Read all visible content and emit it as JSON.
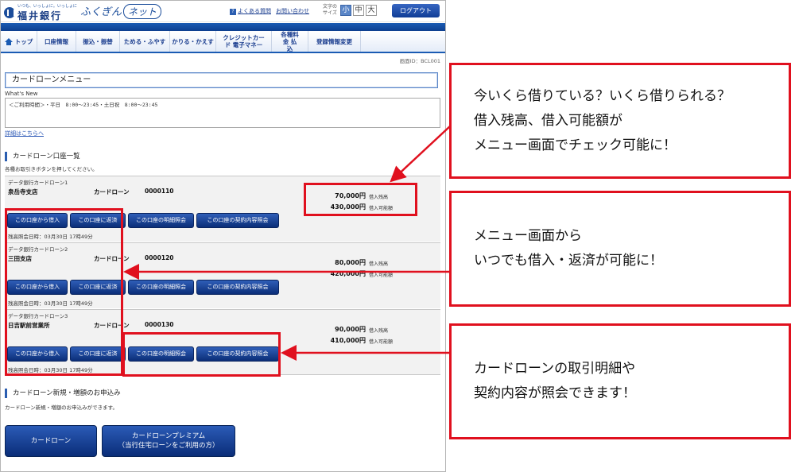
{
  "header": {
    "bank_tagline": "いつも、いっしょに。いっしょに",
    "bank_name": "福井銀行",
    "service_name_a": "ふくぎん",
    "service_name_b": "ネット",
    "faq_link": "よくある質問",
    "contact_link": "お問い合わせ",
    "font_size_label": "文字の サイズ",
    "font_sizes": [
      "小",
      "中",
      "大"
    ],
    "logout_label": "ログアウト"
  },
  "nav": {
    "items": [
      "トップ",
      "口座情報",
      "振込・振替",
      "ためる・ふやす",
      "かりる・かえす",
      "クレジットカード 電子マネー",
      "各種料金 払込",
      "登録情報変更"
    ]
  },
  "screen_id": "画面ID：BCL001",
  "page_title": "カードローンメニュー",
  "whats_new": {
    "label": "What's New",
    "text": "＜ご利用時間＞・平日　8:00～23:45・土日祝　8:00～23:45",
    "detail_link": "詳細はこちらへ"
  },
  "account_section": {
    "heading": "カードローン口座一覧",
    "note": "各種お取引きボタンを押してください。"
  },
  "accounts": [
    {
      "title": "データ銀行カードローン1",
      "branch": "泉岳寺支店",
      "type": "カードローン",
      "number": "0000110",
      "balance": "70,000円",
      "balance_label": "借入残高",
      "available": "430,000円",
      "available_label": "借入可能額",
      "buttons": [
        "この口座から借入",
        "この口座に返済",
        "この口座の明細照会",
        "この口座の契約内容照会"
      ],
      "inquiry_time": "残高照会日時：03月30日 17時49分"
    },
    {
      "title": "データ銀行カードローン2",
      "branch": "三田支店",
      "type": "カードローン",
      "number": "0000120",
      "balance": "80,000円",
      "balance_label": "借入残高",
      "available": "420,000円",
      "available_label": "借入可能額",
      "buttons": [
        "この口座から借入",
        "この口座に返済",
        "この口座の明細照会",
        "この口座の契約内容照会"
      ],
      "inquiry_time": "残高照会日時：03月30日 17時49分"
    },
    {
      "title": "データ銀行カードローン3",
      "branch": "日吉駅前営業所",
      "type": "カードローン",
      "number": "0000130",
      "balance": "90,000円",
      "balance_label": "借入残高",
      "available": "410,000円",
      "available_label": "借入可能額",
      "buttons": [
        "この口座から借入",
        "この口座に返済",
        "この口座の明細照会",
        "この口座の契約内容照会"
      ],
      "inquiry_time": "残高照会日時：03月30日 17時49分"
    }
  ],
  "apply_section": {
    "heading": "カードローン新規・増額のお申込み",
    "note": "カードローン新規・増額のお申込みができます。",
    "buttons": [
      "カードローン",
      "カードローンプレミアム\n（当行住宅ローンをご利用の方）"
    ]
  },
  "callouts": [
    [
      "今いくら借りている？いくら借りられる？",
      "借入残高、借入可能額が",
      "メニュー画面でチェック可能に！"
    ],
    [
      "メニュー画面から",
      "いつでも借入・返済が可能に！"
    ],
    [
      "カードローンの取引明細や",
      "契約内容が照会できます！"
    ]
  ],
  "colors": {
    "brand_blue": "#1a5bb3",
    "button_blue": "#0b2e78",
    "highlight_red": "#e0101e"
  }
}
